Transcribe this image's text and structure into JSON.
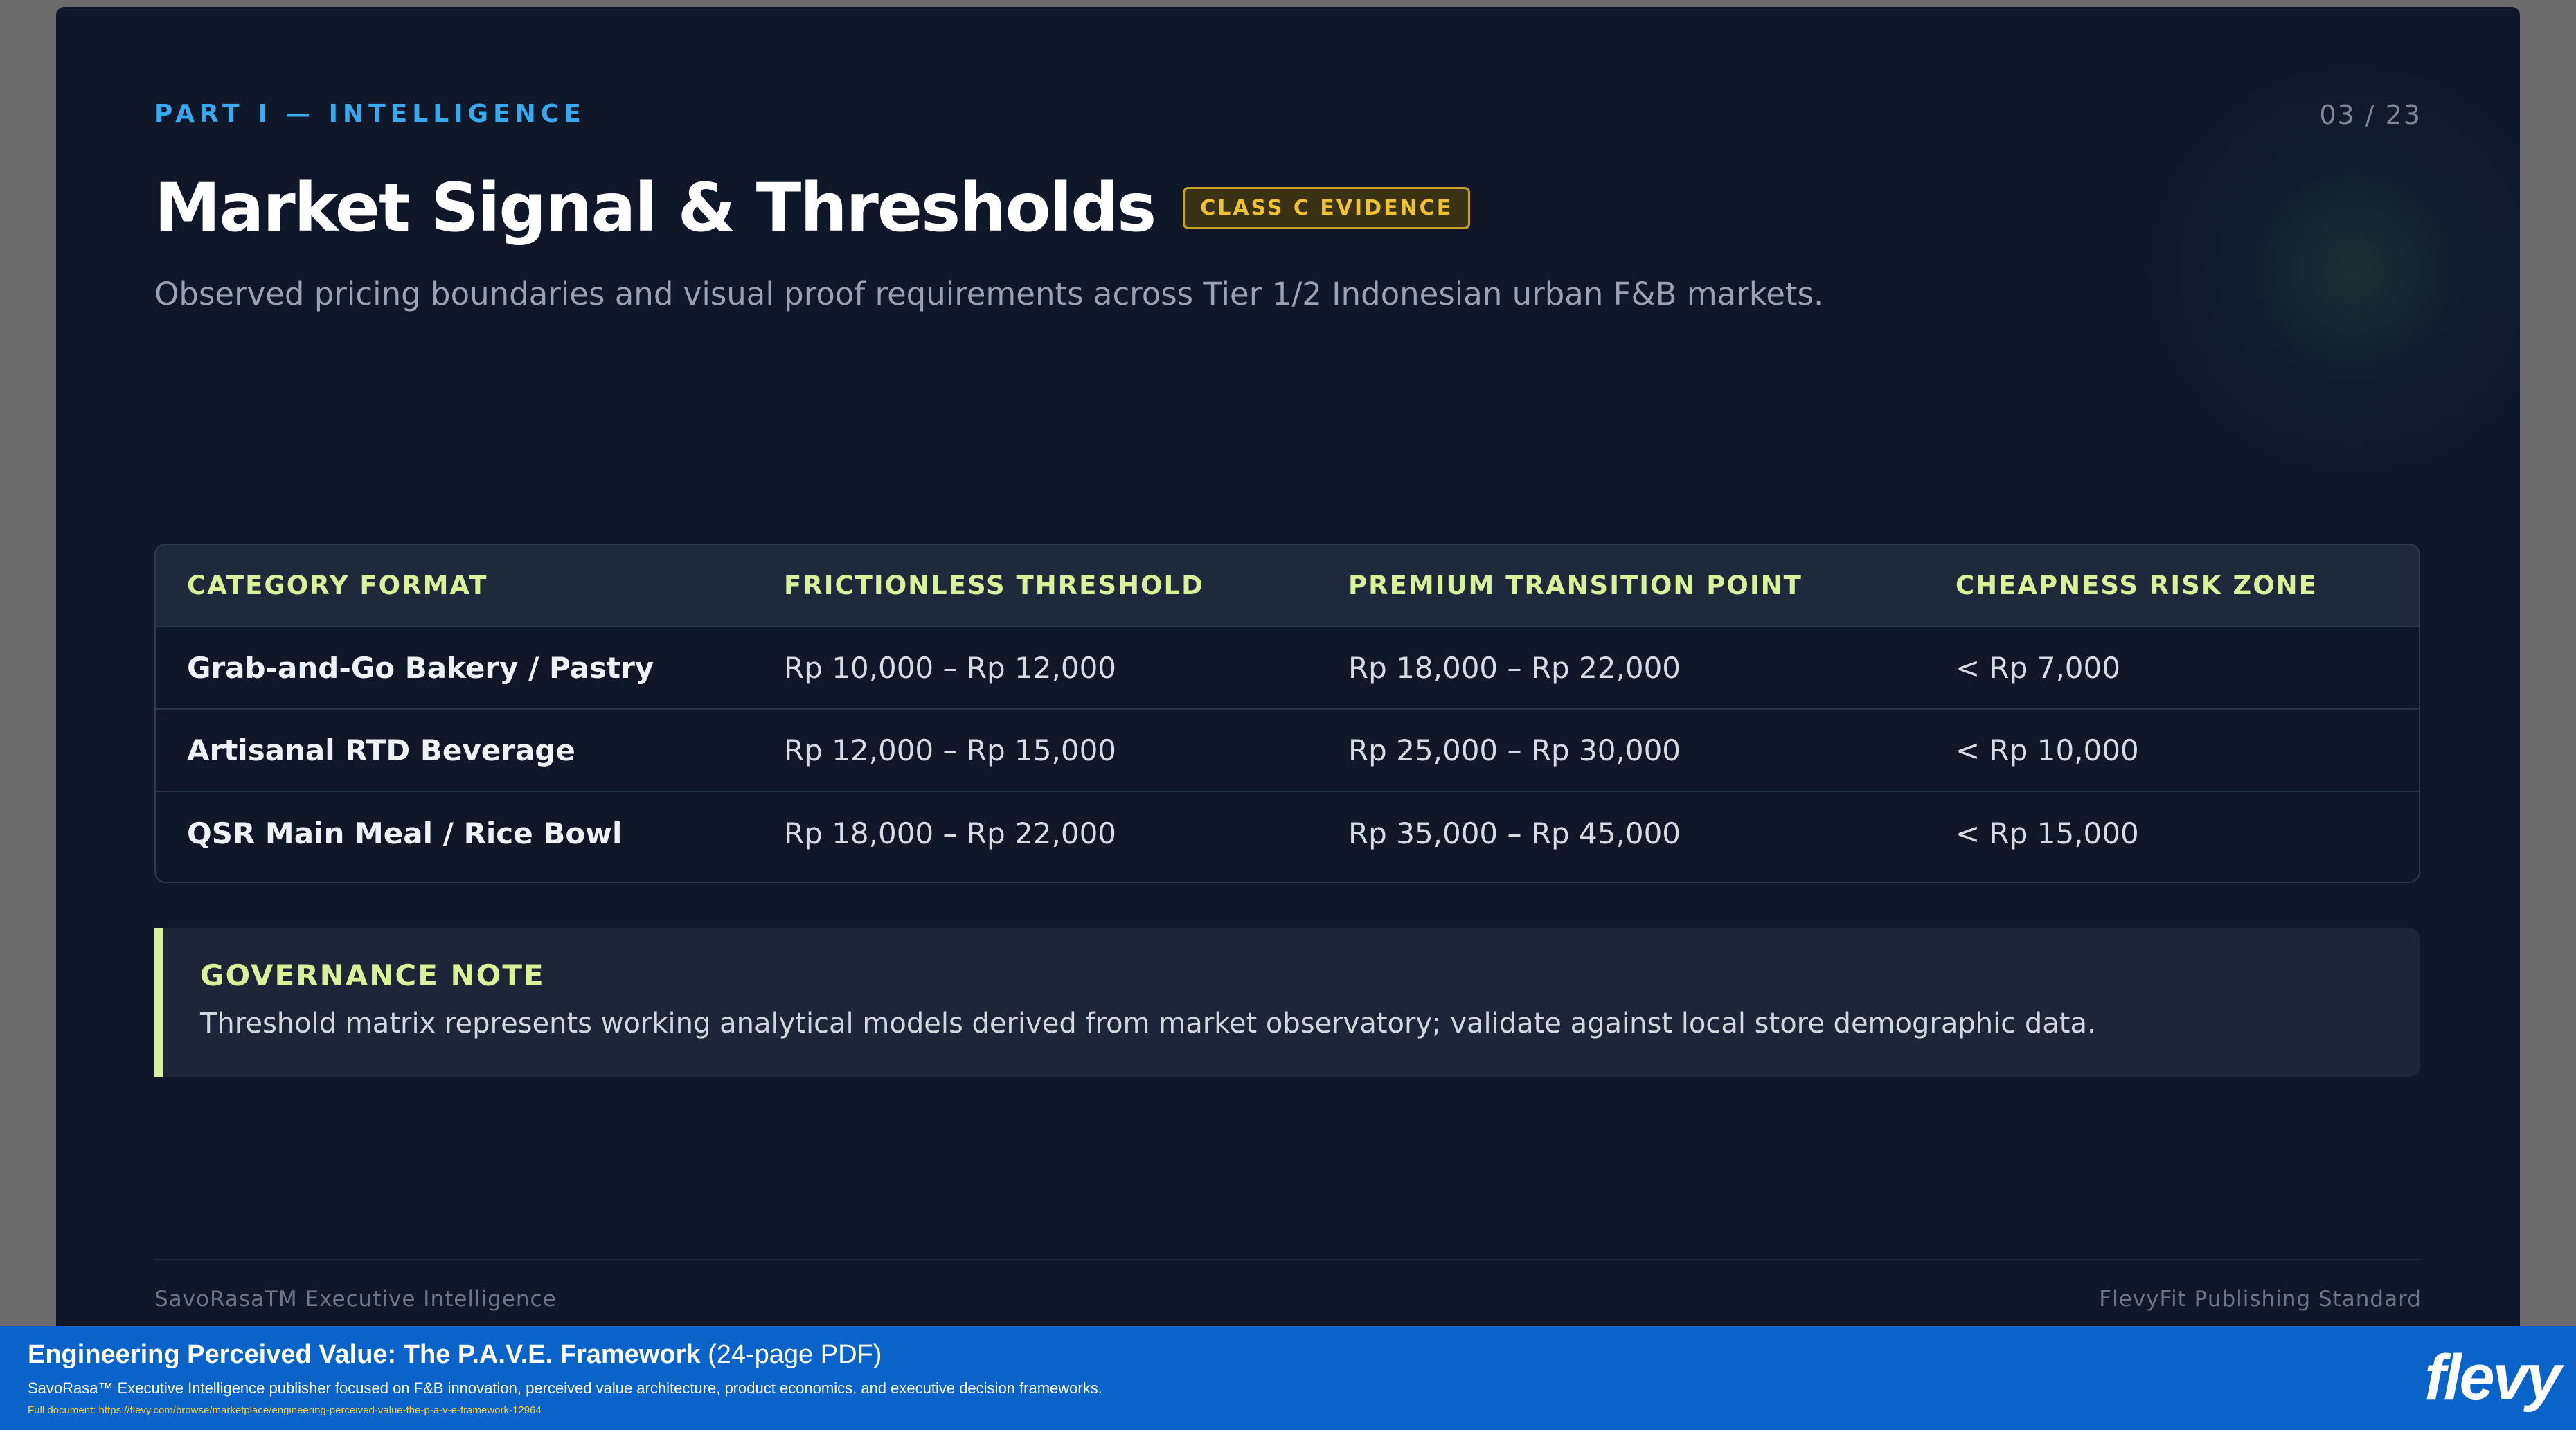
{
  "slide": {
    "section_label": "PART I — INTELLIGENCE",
    "page_number": "03 / 23",
    "title": "Market Signal & Thresholds",
    "badge": "CLASS C EVIDENCE",
    "subtitle": "Observed pricing boundaries and visual proof requirements across Tier 1/2 Indonesian urban F&B markets."
  },
  "table": {
    "headers": [
      "CATEGORY FORMAT",
      "FRICTIONLESS THRESHOLD",
      "PREMIUM TRANSITION POINT",
      "CHEAPNESS RISK ZONE"
    ],
    "rows": [
      [
        "Grab-and-Go Bakery / Pastry",
        "Rp 10,000 – Rp 12,000",
        "Rp 18,000 – Rp 22,000",
        "< Rp 7,000"
      ],
      [
        "Artisanal RTD Beverage",
        "Rp 12,000 – Rp 15,000",
        "Rp 25,000 – Rp 30,000",
        "< Rp 10,000"
      ],
      [
        "QSR Main Meal / Rice Bowl",
        "Rp 18,000 – Rp 22,000",
        "Rp 35,000 – Rp 45,000",
        "< Rp 15,000"
      ]
    ]
  },
  "note": {
    "title": "GOVERNANCE NOTE",
    "text": "Threshold matrix represents working analytical models derived from market observatory; validate against local store demographic data."
  },
  "footer": {
    "left": "SavoRasaTM Executive Intelligence",
    "right": "FlevyFit Publishing Standard"
  },
  "banner": {
    "title": "Engineering Perceived Value: The P.A.V.E. Framework",
    "pages": "(24-page PDF)",
    "description": "SavoRasa™ Executive Intelligence publisher focused on F&B innovation, perceived value architecture, product economics, and executive decision frameworks.",
    "link": "Full document: https://flevy.com/browse/marketplace/engineering-perceived-value-the-p-a-v-e-framework-12964",
    "logo": "flevy"
  },
  "colors": {
    "slide_bg": "#0f1729",
    "accent_blue": "#38a9ee",
    "accent_lime": "#d9f29a",
    "badge_gold": "#f0c232",
    "banner_blue": "#0a63c9"
  }
}
